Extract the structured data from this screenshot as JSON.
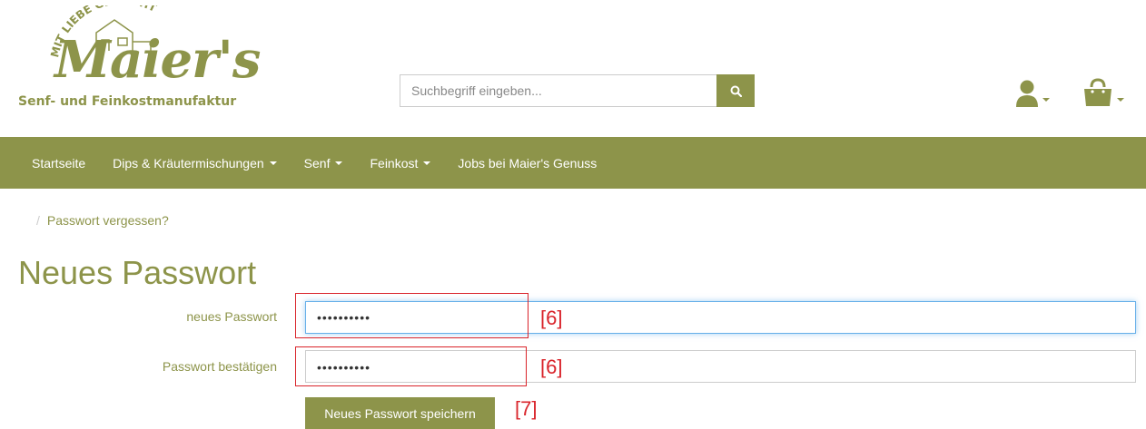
{
  "brand": {
    "arc_text": "MIT LIEBE GEMACHT",
    "script_name": "Maier's",
    "subtitle": "Senf- und Feinkostmanufaktur",
    "color": "#8d944a"
  },
  "search": {
    "placeholder": "Suchbegriff eingeben...",
    "icon": "search-icon"
  },
  "header_icons": {
    "user": "user-icon",
    "cart": "shopping-bag-icon"
  },
  "nav": {
    "items": [
      {
        "label": "Startseite",
        "dropdown": false
      },
      {
        "label": "Dips & Kräutermischungen",
        "dropdown": true
      },
      {
        "label": "Senf",
        "dropdown": true
      },
      {
        "label": "Feinkost",
        "dropdown": true
      },
      {
        "label": "Jobs bei Maier's Genuss",
        "dropdown": false
      }
    ]
  },
  "breadcrumb": {
    "separator": "/",
    "current": "Passwort vergessen?"
  },
  "page": {
    "title": "Neues Passwort"
  },
  "form": {
    "new_password": {
      "label": "neues Passwort",
      "value": "••••••••••"
    },
    "confirm_password": {
      "label": "Passwort bestätigen",
      "value": "••••••••••"
    },
    "submit_label": "Neues Passwort speichern"
  },
  "annotations": {
    "pw1": "[6]",
    "pw2": "[6]",
    "submit": "[7]",
    "color": "#d9232a"
  }
}
